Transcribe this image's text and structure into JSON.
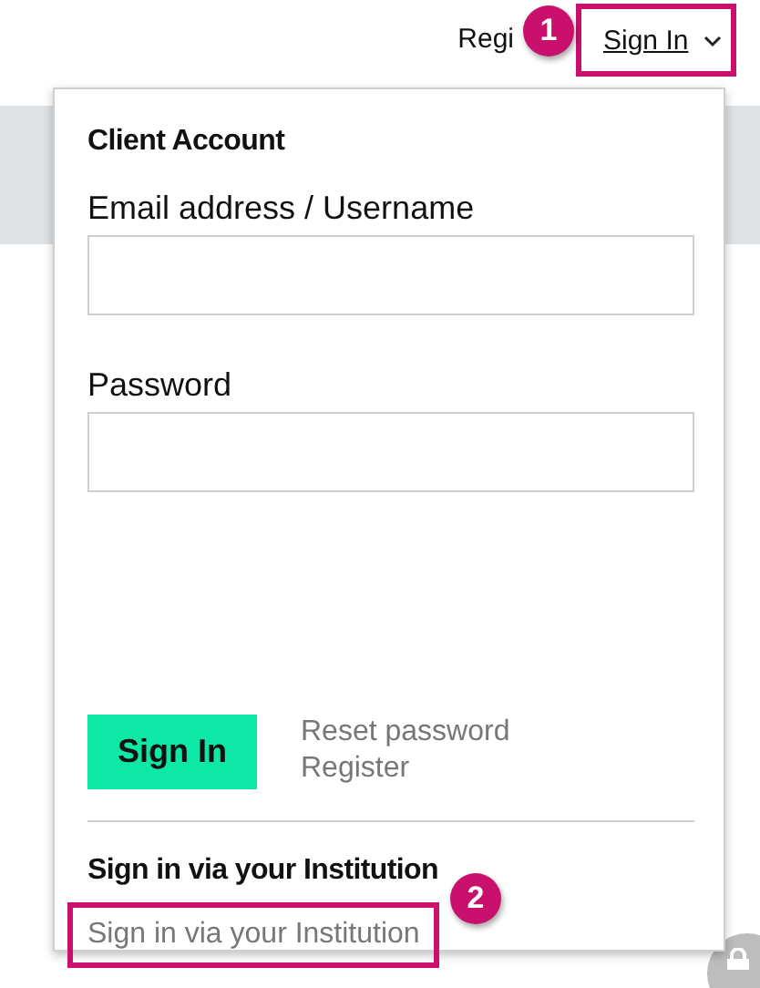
{
  "header": {
    "register_link": "Regi",
    "signin_menu": {
      "label": "Sign In",
      "expanded": true
    }
  },
  "callouts": [
    "1",
    "2"
  ],
  "dropdown": {
    "title": "Client Account",
    "fields": [
      {
        "label": "Email address / Username"
      },
      {
        "label": "Password"
      }
    ],
    "submit": "Sign In",
    "links": [
      "Reset password",
      "Register"
    ],
    "institution": {
      "heading": "Sign in via your Institution",
      "link": "Sign in via your Institution"
    }
  }
}
